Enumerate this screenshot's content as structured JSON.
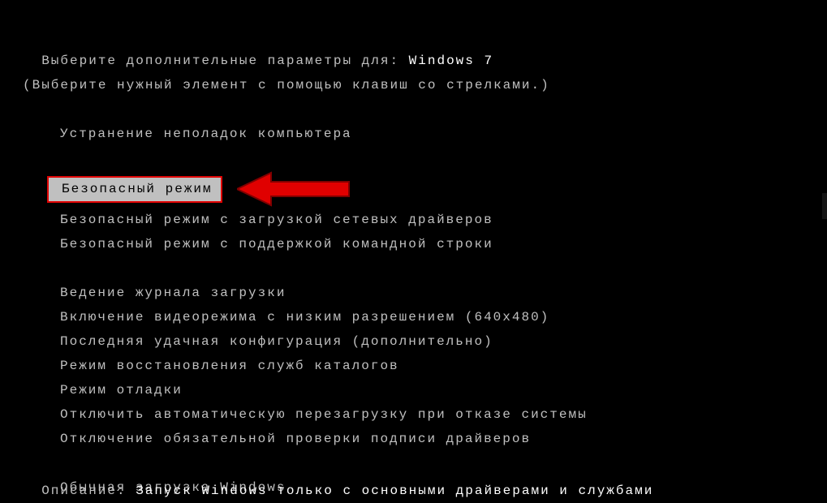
{
  "header": {
    "prompt_prefix": "Выберите дополнительные параметры для: ",
    "os_name": "Windows 7",
    "hint": "(Выберите нужный элемент с помощью клавиш со стрелками.)"
  },
  "menu": {
    "repair": "Устранение неполадок компьютера",
    "safe_mode": "Безопасный режим",
    "safe_mode_network": "Безопасный режим с загрузкой сетевых драйверов",
    "safe_mode_cmd": "Безопасный режим с поддержкой командной строки",
    "boot_logging": "Ведение журнала загрузки",
    "low_res_video": "Включение видеорежима с низким разрешением (640x480)",
    "last_known_good": "Последняя удачная конфигурация (дополнительно)",
    "ds_restore": "Режим восстановления служб каталогов",
    "debug_mode": "Режим отладки",
    "disable_auto_restart": "Отключить автоматическую перезагрузку при отказе системы",
    "disable_driver_sig": "Отключение обязательной проверки подписи драйверов",
    "normal_boot": "Обычная загрузка Windows"
  },
  "footer": {
    "desc_label": "Описание: ",
    "desc_value": "Запуск Windows только с основными драйверами и службами"
  }
}
